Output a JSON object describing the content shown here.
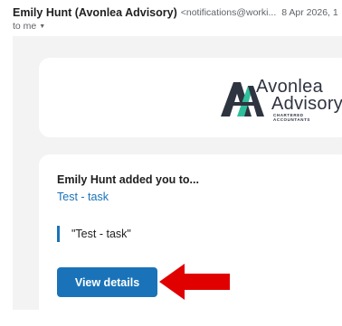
{
  "email": {
    "sender_name": "Emily Hunt (Avonlea Advisory)",
    "sender_address": "<notifications@worki...",
    "date": "8 Apr 2026, 1",
    "recipient": "to me"
  },
  "logo": {
    "word1": "Avonlea",
    "word2": "Advisory",
    "tagline": "CHARTERED ACCOUNTANTS",
    "colors": {
      "dark": "#2e3440",
      "accent": "#2fbf9b"
    }
  },
  "message": {
    "added_text": "Emily Hunt added you to...",
    "task_link": "Test - task",
    "quote": "\"Test - task\"",
    "button_label": "View details"
  },
  "colors": {
    "accent": "#1a73b8",
    "annotation_arrow": "#e00000"
  }
}
